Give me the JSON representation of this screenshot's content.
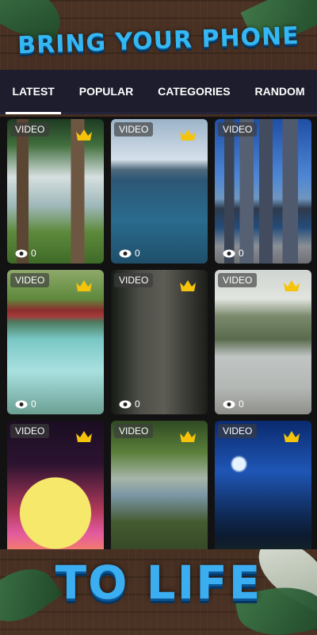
{
  "header": {
    "title": "BRING YOUR PHONE"
  },
  "tabs": [
    {
      "label": "LATEST",
      "active": true
    },
    {
      "label": "POPULAR",
      "active": false
    },
    {
      "label": "CATEGORIES",
      "active": false
    },
    {
      "label": "RANDOM",
      "active": false
    }
  ],
  "cards": [
    {
      "badge": "VIDEO",
      "views": "0",
      "premium": true,
      "subject": "forest lake"
    },
    {
      "badge": "VIDEO",
      "views": "0",
      "premium": true,
      "subject": "mountain lake"
    },
    {
      "badge": "VIDEO",
      "views": "0",
      "premium": false,
      "subject": "city skyline"
    },
    {
      "badge": "VIDEO",
      "views": "0",
      "premium": true,
      "subject": "river bridge"
    },
    {
      "badge": "VIDEO",
      "views": "0",
      "premium": true,
      "subject": "forest stream"
    },
    {
      "badge": "VIDEO",
      "views": "0",
      "premium": true,
      "subject": "couple by sea"
    },
    {
      "badge": "VIDEO",
      "views": "",
      "premium": true,
      "subject": "retro sunset"
    },
    {
      "badge": "VIDEO",
      "views": "",
      "premium": true,
      "subject": "flower by river"
    },
    {
      "badge": "VIDEO",
      "views": "",
      "premium": true,
      "subject": "night sky"
    }
  ],
  "footer": {
    "title": "TO LIFE"
  },
  "colors": {
    "tab_bar": "#1d1d2d",
    "accent_title": "#34b7f2",
    "crown": "#f5c40a"
  },
  "icons": {
    "crown": "crown-icon",
    "views": "eye-icon"
  }
}
